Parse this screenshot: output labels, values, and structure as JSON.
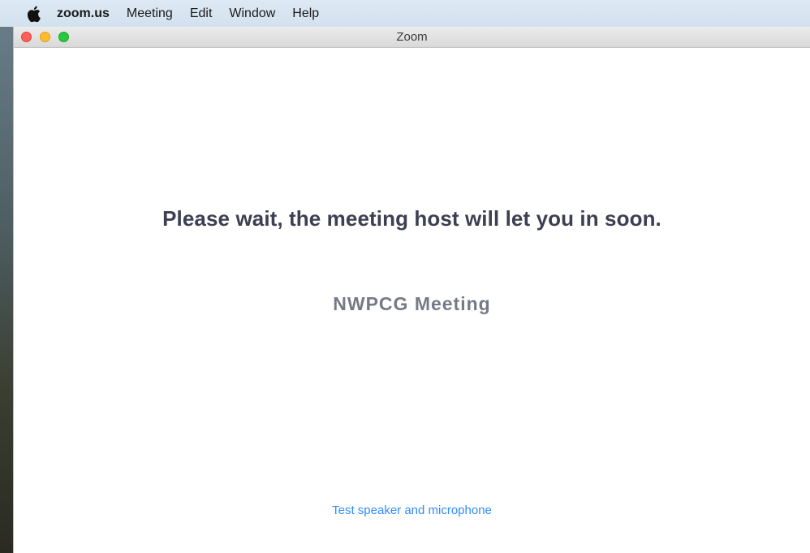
{
  "menubar": {
    "apple_icon": "apple-icon",
    "app_name": "zoom.us",
    "items": [
      "Meeting",
      "Edit",
      "Window",
      "Help"
    ]
  },
  "window": {
    "title": "Zoom",
    "controls": [
      "close",
      "minimize",
      "maximize"
    ],
    "colors": {
      "close": "#fc5f57",
      "minimize": "#fdbc2e",
      "maximize": "#28c840"
    }
  },
  "waiting_room": {
    "message": "Please wait, the meeting host will let you in soon.",
    "meeting_name": "NWPCG Meeting",
    "test_link": "Test speaker and microphone",
    "link_color": "#2d8cff"
  }
}
